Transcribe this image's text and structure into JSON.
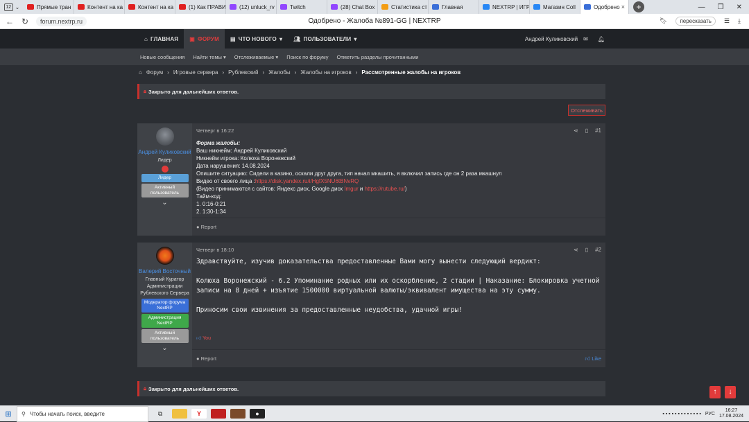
{
  "browser": {
    "tab_count": "12",
    "tabs": [
      {
        "label": "Прямые тран",
        "color": "#e02020"
      },
      {
        "label": "Контент на ка",
        "color": "#e02020"
      },
      {
        "label": "Контент на ка",
        "color": "#e02020"
      },
      {
        "label": "(1) Как ПРАВИ",
        "color": "#e02020"
      },
      {
        "label": "(12) unluck_rv",
        "color": "#9146ff"
      },
      {
        "label": "Twitch",
        "color": "#9146ff"
      },
      {
        "label": "(28) Chat Box",
        "color": "#9146ff"
      },
      {
        "label": "Статистика ст",
        "color": "#f39c12"
      },
      {
        "label": "Главная",
        "color": "#3b6fd8"
      },
      {
        "label": "NEXTRP | ИГР",
        "color": "#2787f5"
      },
      {
        "label": "Магазин Coll",
        "color": "#2787f5"
      }
    ],
    "active_tab": "Одобрено",
    "url": "forum.nextrp.ru",
    "page_title": "Одобрено - Жалоба №891-GG | NEXTRP",
    "translate_label": "пересказать"
  },
  "nav": {
    "home": "ГЛАВНАЯ",
    "forum": "ФОРУМ",
    "whats_new": "ЧТО НОВОГО",
    "users": "ПОЛЬЗОВАТЕЛИ",
    "username": "Андрей Куликовский"
  },
  "subnav": {
    "new_posts": "Новые сообщения",
    "find_threads": "Найти темы",
    "watched": "Отслеживаемые",
    "search_forum": "Поиск по форуму",
    "mark_read": "Отметить разделы прочитанными"
  },
  "breadcrumbs": [
    "Форум",
    "Игровые сервера",
    "Рублевский",
    "Жалобы",
    "Жалобы на игроков",
    "Рассмотренные жалобы на игроков"
  ],
  "notice_closed": "Закрыто для дальнейших ответов.",
  "watch_button": "Отслеживать",
  "post1": {
    "author": "Андрей Куликовский",
    "title": "Лидер",
    "badge1": "Лидер",
    "badge2": "Активный пользователь",
    "date": "Четверг в 16:22",
    "number": "#1",
    "form_title": "Форма жалобы:",
    "line1": "Ваш никнейм: Андрей Куликовский",
    "line2": "Никнейм игрока: Колюха Воронежский",
    "line3": "Дата нарушения: 14.08.2024",
    "line4": "Опишите ситуацию: Сидели в казино, оскали друг друга, тип начал мкашить, я включил запись где он 2 раза мкашнул",
    "video_label": "Видео от своего лица :",
    "video_link": "https://disk.yandex.ru/i/HgfX5NU6tBNvRQ",
    "sites_prefix": "(Видео принимаются с сайтов: Яндекс диск, Google диск ",
    "imgur": "Imgur",
    "and": " и ",
    "rutube": "https://rutube.ru/",
    "sites_suffix": ")",
    "timecode_label": "Тайм-код:",
    "tc1": "1. 0:16-0:21",
    "tc2": "2. 1:30-1:34",
    "report": "Report"
  },
  "post2": {
    "author": "Валерий Восточный",
    "title": "Главный Куратор Администрации Рублевского Сервера",
    "badge1": "Модератор форума NextRP",
    "badge2": "Администрация NextRP",
    "badge3": "Активный пользователь",
    "date": "Четверг в 18:10",
    "number": "#2",
    "p1": "Здравствуйте, изучив доказательства предоставленные Вами могу вынести следующий вердикт:",
    "p2": "Колюха Воронежский - 6.2 Упоминание родных или их оскорбление, 2 стадии | Наказание: Блокировка учетной записи на 8 дней + изъятие 1500000 виртуальной валюты/эквивалент имущества на эту сумму.",
    "p3": "Приносим свои извинения за предоставленные неудобства, удачной игры!",
    "reaction": "You",
    "report": "Report",
    "like": "Like"
  },
  "taskbar": {
    "search_placeholder": "Чтобы начать поиск, введите",
    "lang": "РУС",
    "time": "16:27",
    "date": "17.08.2024"
  }
}
